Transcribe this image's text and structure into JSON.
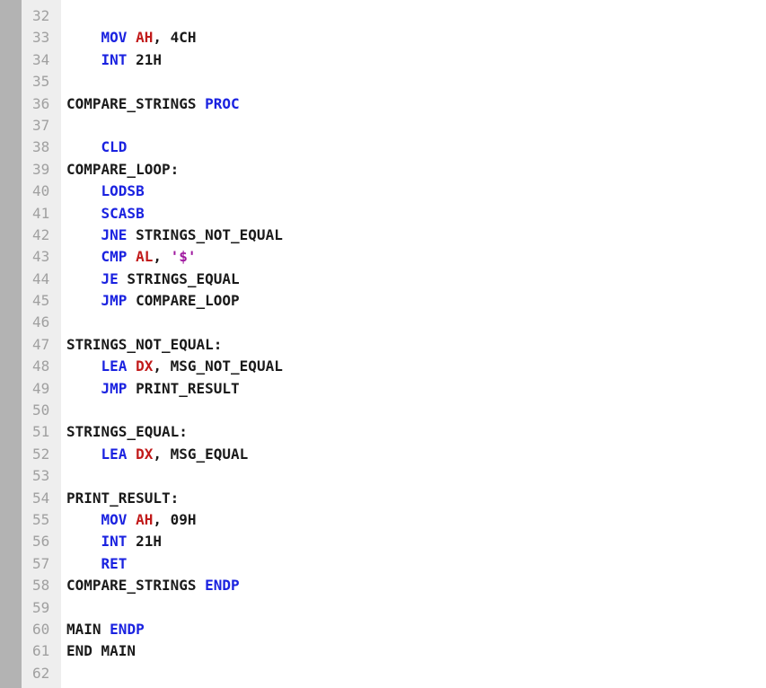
{
  "editor": {
    "lines": [
      {
        "n": "32",
        "tokens": []
      },
      {
        "n": "33",
        "tokens": [
          {
            "t": "    "
          },
          {
            "t": "MOV",
            "c": "kw"
          },
          {
            "t": " "
          },
          {
            "t": "AH",
            "c": "reg"
          },
          {
            "t": ", 4CH"
          }
        ]
      },
      {
        "n": "34",
        "tokens": [
          {
            "t": "    "
          },
          {
            "t": "INT",
            "c": "kw"
          },
          {
            "t": " 21H"
          }
        ]
      },
      {
        "n": "35",
        "tokens": []
      },
      {
        "n": "36",
        "tokens": [
          {
            "t": "COMPARE_STRINGS "
          },
          {
            "t": "PROC",
            "c": "kw"
          }
        ]
      },
      {
        "n": "37",
        "tokens": []
      },
      {
        "n": "38",
        "tokens": [
          {
            "t": "    "
          },
          {
            "t": "CLD",
            "c": "kw"
          }
        ]
      },
      {
        "n": "39",
        "tokens": [
          {
            "t": "COMPARE_LOOP:"
          }
        ]
      },
      {
        "n": "40",
        "tokens": [
          {
            "t": "    "
          },
          {
            "t": "LODSB",
            "c": "kw"
          }
        ]
      },
      {
        "n": "41",
        "tokens": [
          {
            "t": "    "
          },
          {
            "t": "SCASB",
            "c": "kw"
          }
        ]
      },
      {
        "n": "42",
        "tokens": [
          {
            "t": "    "
          },
          {
            "t": "JNE",
            "c": "kw"
          },
          {
            "t": " STRINGS_NOT_EQUAL"
          }
        ]
      },
      {
        "n": "43",
        "tokens": [
          {
            "t": "    "
          },
          {
            "t": "CMP",
            "c": "kw"
          },
          {
            "t": " "
          },
          {
            "t": "AL",
            "c": "reg"
          },
          {
            "t": ", "
          },
          {
            "t": "'$'",
            "c": "str"
          }
        ]
      },
      {
        "n": "44",
        "tokens": [
          {
            "t": "    "
          },
          {
            "t": "JE",
            "c": "kw"
          },
          {
            "t": " STRINGS_EQUAL"
          }
        ]
      },
      {
        "n": "45",
        "tokens": [
          {
            "t": "    "
          },
          {
            "t": "JMP",
            "c": "kw"
          },
          {
            "t": " COMPARE_LOOP"
          }
        ]
      },
      {
        "n": "46",
        "tokens": []
      },
      {
        "n": "47",
        "tokens": [
          {
            "t": "STRINGS_NOT_EQUAL:"
          }
        ]
      },
      {
        "n": "48",
        "tokens": [
          {
            "t": "    "
          },
          {
            "t": "LEA",
            "c": "kw"
          },
          {
            "t": " "
          },
          {
            "t": "DX",
            "c": "reg"
          },
          {
            "t": ", MSG_NOT_EQUAL"
          }
        ]
      },
      {
        "n": "49",
        "tokens": [
          {
            "t": "    "
          },
          {
            "t": "JMP",
            "c": "kw"
          },
          {
            "t": " PRINT_RESULT"
          }
        ]
      },
      {
        "n": "50",
        "tokens": []
      },
      {
        "n": "51",
        "tokens": [
          {
            "t": "STRINGS_EQUAL:"
          }
        ]
      },
      {
        "n": "52",
        "tokens": [
          {
            "t": "    "
          },
          {
            "t": "LEA",
            "c": "kw"
          },
          {
            "t": " "
          },
          {
            "t": "DX",
            "c": "reg"
          },
          {
            "t": ", MSG_EQUAL"
          }
        ]
      },
      {
        "n": "53",
        "tokens": []
      },
      {
        "n": "54",
        "tokens": [
          {
            "t": "PRINT_RESULT:"
          }
        ]
      },
      {
        "n": "55",
        "tokens": [
          {
            "t": "    "
          },
          {
            "t": "MOV",
            "c": "kw"
          },
          {
            "t": " "
          },
          {
            "t": "AH",
            "c": "reg"
          },
          {
            "t": ", 09H"
          }
        ]
      },
      {
        "n": "56",
        "tokens": [
          {
            "t": "    "
          },
          {
            "t": "INT",
            "c": "kw"
          },
          {
            "t": " 21H"
          }
        ]
      },
      {
        "n": "57",
        "tokens": [
          {
            "t": "    "
          },
          {
            "t": "RET",
            "c": "kw"
          }
        ]
      },
      {
        "n": "58",
        "tokens": [
          {
            "t": "COMPARE_STRINGS "
          },
          {
            "t": "ENDP",
            "c": "kw"
          }
        ]
      },
      {
        "n": "59",
        "tokens": []
      },
      {
        "n": "60",
        "tokens": [
          {
            "t": "MAIN "
          },
          {
            "t": "ENDP",
            "c": "kw"
          }
        ]
      },
      {
        "n": "61",
        "tokens": [
          {
            "t": "END MAIN"
          }
        ]
      },
      {
        "n": "62",
        "tokens": []
      }
    ]
  },
  "colors": {
    "keyword": "#1a22e0",
    "register": "#c11a1a",
    "string": "#a01aa0",
    "plain": "#1a1a1a",
    "line_number": "#a0a0a0",
    "gutter_bg": "#eeeeee",
    "left_bar": "#b3b3b3"
  }
}
